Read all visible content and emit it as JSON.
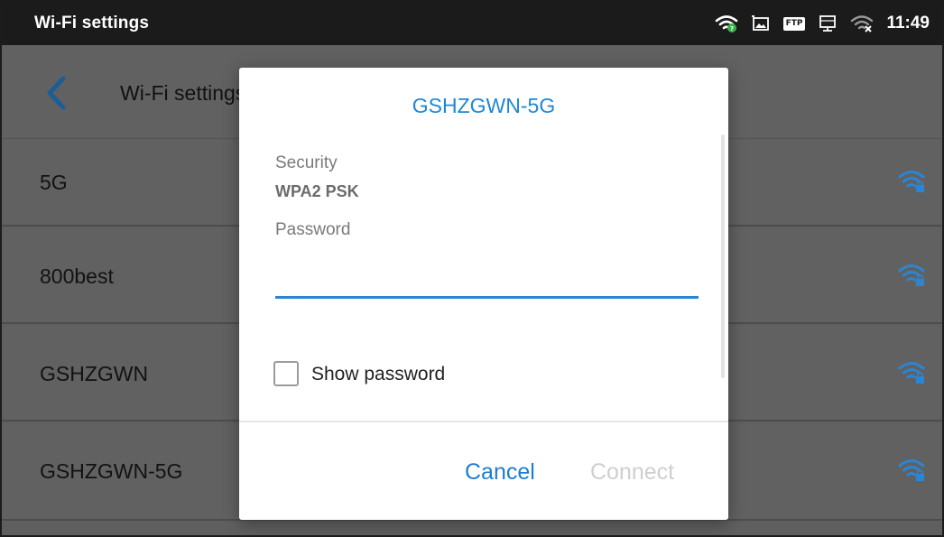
{
  "statusbar": {
    "title": "Wi-Fi settings",
    "time": "11:49",
    "ftp_badge": "FTP",
    "icons": [
      "wifi-connected-icon",
      "image-icon",
      "ftp-icon",
      "network-icon",
      "wifi-off-icon"
    ]
  },
  "appbar": {
    "title": "Wi-Fi settings",
    "back_icon": "chevron-left-icon"
  },
  "networks": [
    {
      "name": "5G",
      "icon": "wifi-lock-icon"
    },
    {
      "name": "800best",
      "icon": "wifi-lock-icon"
    },
    {
      "name": "GSHZGWN",
      "icon": "wifi-lock-icon"
    },
    {
      "name": "GSHZGWN-5G",
      "icon": "wifi-lock-icon"
    }
  ],
  "dialog": {
    "title": "GSHZGWN-5G",
    "security_label": "Security",
    "security_value": "WPA2 PSK",
    "password_label": "Password",
    "password_value": "",
    "show_password_label": "Show password",
    "show_password_checked": false,
    "cancel_label": "Cancel",
    "connect_label": "Connect"
  },
  "colors": {
    "accent": "#1e88d6",
    "wifi_icon": "#2a86d4",
    "overlay_bg": "#616161",
    "statusbar_bg": "#1b1b1b"
  }
}
